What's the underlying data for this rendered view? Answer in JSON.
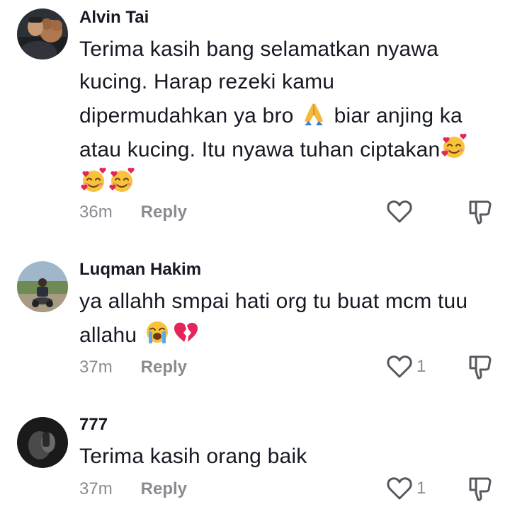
{
  "comments": [
    {
      "username": "Alvin Tai",
      "text_line1": "Terima kasih bang selamatkan nyawa",
      "text_line2": "kucing. Harap rezeki kamu",
      "text_line3a": "dipermudahkan ya bro",
      "text_line3b": "biar anjing ka",
      "text_line4": "atau kucing. Itu nyawa tuhan ciptakan",
      "time": "36m",
      "reply_label": "Reply",
      "like_count": "",
      "emojis": [
        "folded-hands",
        "smiling-face-with-hearts",
        "smiling-face-with-hearts",
        "smiling-face-with-hearts"
      ]
    },
    {
      "username": "Luqman Hakim",
      "text_line1": "ya allahh smpai hati org tu buat mcm tuu",
      "text_line2": "allahu",
      "time": "37m",
      "reply_label": "Reply",
      "like_count": "1",
      "emojis": [
        "loudly-crying-face",
        "broken-heart"
      ]
    },
    {
      "username": "777",
      "text_line1": "Terima kasih orang baik",
      "time": "37m",
      "reply_label": "Reply",
      "like_count": "1",
      "emojis": []
    }
  ],
  "icons": {
    "like": "heart-outline-icon",
    "dislike": "thumbs-down-outline-icon"
  },
  "colors": {
    "text": "#161823",
    "meta": "#8a8b91",
    "icon": "#57585f"
  }
}
